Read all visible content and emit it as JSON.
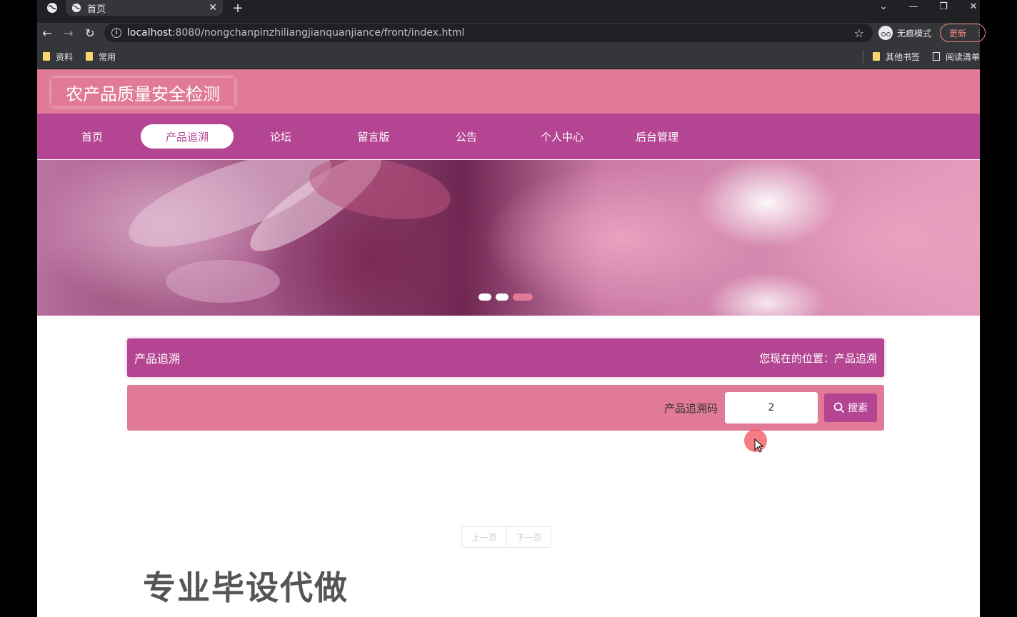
{
  "browser": {
    "tab_title": "首页",
    "url_host": "localhost",
    "url_rest": ":8080/nongchanpinzhiliangjianquanjiance/front/index.html",
    "incognito_label": "无痕模式",
    "update_label": "更新",
    "bookmarks": [
      {
        "label": "资料",
        "icon": "folder-icon"
      },
      {
        "label": "常用",
        "icon": "folder-icon"
      }
    ],
    "other_bookmarks": "其他书签",
    "reading_list": "阅读清单"
  },
  "site": {
    "title": "农产品质量安全检测",
    "nav": [
      {
        "label": "首页",
        "active": false
      },
      {
        "label": "产品追溯",
        "active": true
      },
      {
        "label": "论坛",
        "active": false
      },
      {
        "label": "留言版",
        "active": false
      },
      {
        "label": "公告",
        "active": false
      },
      {
        "label": "个人中心",
        "active": false
      },
      {
        "label": "后台管理",
        "active": false
      }
    ],
    "carousel": {
      "slides": 3,
      "active_index": 2
    }
  },
  "section": {
    "title": "产品追溯",
    "location": "您现在的位置：产品追溯"
  },
  "search": {
    "label": "产品追溯码",
    "value": "2",
    "button": "搜索"
  },
  "pager": {
    "prev": "上一页",
    "next": "下一页"
  },
  "watermark": "专业毕设代做",
  "colors": {
    "header": "#e07a96",
    "nav": "#b44592",
    "search_bar": "#e07a96"
  }
}
